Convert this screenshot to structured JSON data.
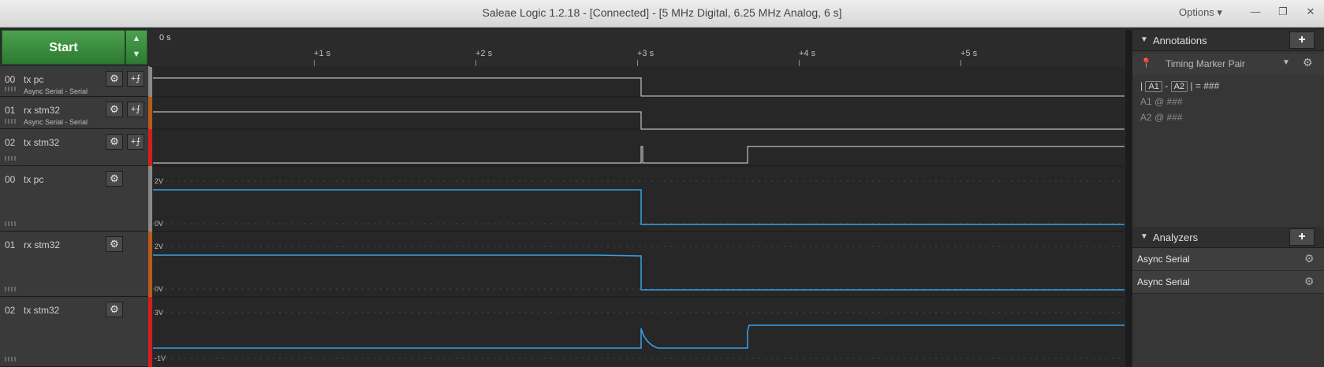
{
  "window": {
    "title": "Saleae Logic 1.2.18 - [Connected] - [5 MHz Digital, 6.25 MHz Analog, 6 s]",
    "options_label": "Options ▾",
    "minimize": "—",
    "maximize": "❐",
    "close": "✕"
  },
  "start": {
    "label": "Start",
    "up": "▲",
    "down": "▼"
  },
  "timeline": {
    "origin_label": "0 s",
    "ticks": [
      "+1 s",
      "+2 s",
      "+3 s",
      "+4 s",
      "+5 s"
    ]
  },
  "channels": [
    {
      "num": "00",
      "name": "tx pc",
      "sub": "Async Serial - Serial",
      "color": "#8a8a8a"
    },
    {
      "num": "01",
      "name": "rx stm32",
      "sub": "Async Serial - Serial",
      "color": "#b85c1a"
    },
    {
      "num": "02",
      "name": "tx stm32",
      "sub": "",
      "color": "#d21f1f"
    },
    {
      "num": "00",
      "name": "tx pc",
      "sub": "",
      "color": "#8a8a8a"
    },
    {
      "num": "01",
      "name": "rx stm32",
      "sub": "",
      "color": "#b85c1a"
    },
    {
      "num": "02",
      "name": "tx stm32",
      "sub": "",
      "color": "#d21f1f"
    }
  ],
  "analog_scales": [
    {
      "top": "2V",
      "bottom": "0V"
    },
    {
      "top": "2V",
      "bottom": "0V"
    },
    {
      "top": "3V",
      "bottom": "-1V"
    }
  ],
  "icons": {
    "gear": "gear-icon",
    "trigger": "trigger-edge-icon"
  },
  "annotations": {
    "title": "Annotations",
    "add": "+",
    "marker_pair": "Timing Marker Pair",
    "formula": {
      "a1": "A1",
      "minus": "-",
      "a2": "A2",
      "eq": "= ###"
    },
    "a1_row": "A1  @  ###",
    "a2_row": "A2  @  ###"
  },
  "analyzers": {
    "title": "Analyzers",
    "add": "+",
    "items": [
      "Async Serial",
      "Async Serial"
    ]
  },
  "colors": {
    "accent_green": "#3a8c3e",
    "analog_trace": "#3a9fe8",
    "digital_trace": "#e0e0e0"
  }
}
